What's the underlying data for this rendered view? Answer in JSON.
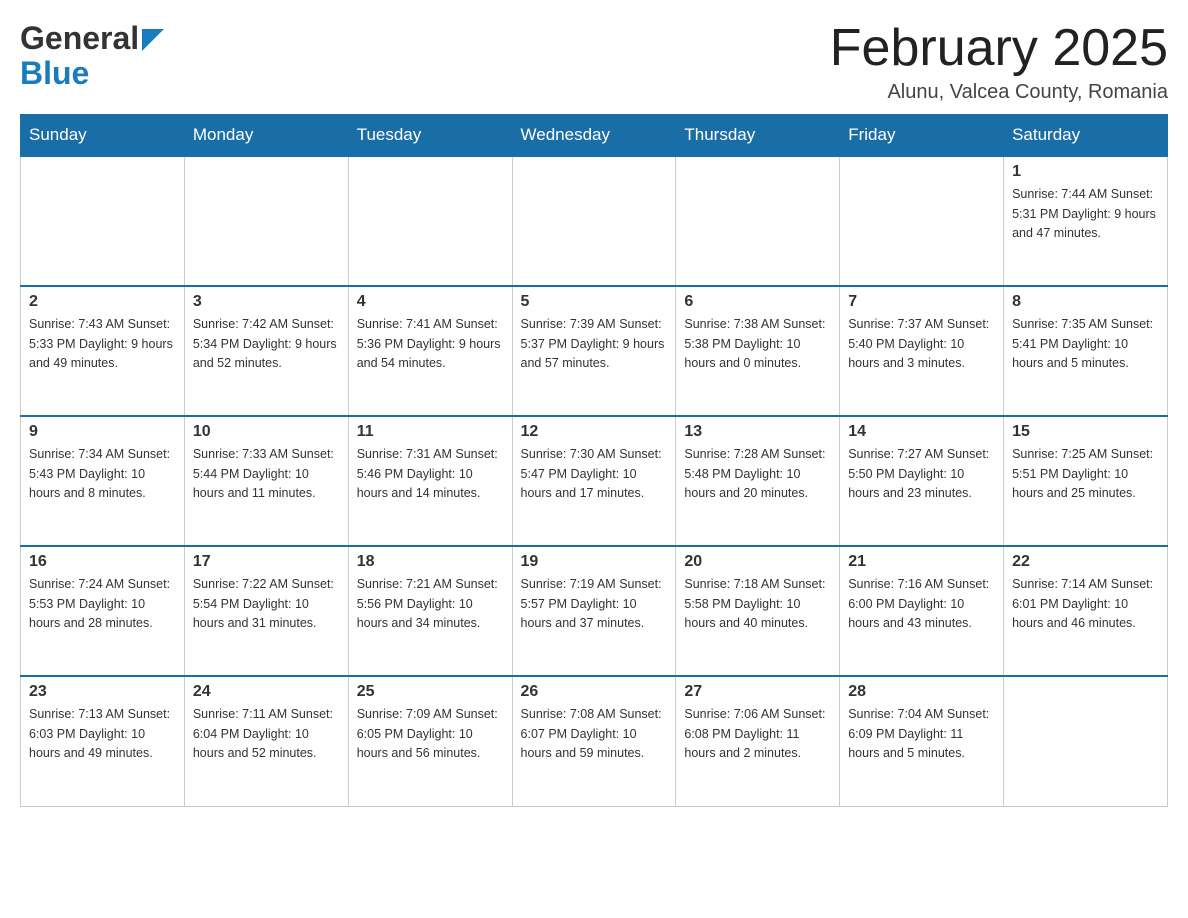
{
  "header": {
    "logo_general": "General",
    "logo_blue": "Blue",
    "month_title": "February 2025",
    "location": "Alunu, Valcea County, Romania"
  },
  "days_of_week": [
    "Sunday",
    "Monday",
    "Tuesday",
    "Wednesday",
    "Thursday",
    "Friday",
    "Saturday"
  ],
  "weeks": [
    [
      {
        "day": "",
        "info": ""
      },
      {
        "day": "",
        "info": ""
      },
      {
        "day": "",
        "info": ""
      },
      {
        "day": "",
        "info": ""
      },
      {
        "day": "",
        "info": ""
      },
      {
        "day": "",
        "info": ""
      },
      {
        "day": "1",
        "info": "Sunrise: 7:44 AM\nSunset: 5:31 PM\nDaylight: 9 hours\nand 47 minutes."
      }
    ],
    [
      {
        "day": "2",
        "info": "Sunrise: 7:43 AM\nSunset: 5:33 PM\nDaylight: 9 hours\nand 49 minutes."
      },
      {
        "day": "3",
        "info": "Sunrise: 7:42 AM\nSunset: 5:34 PM\nDaylight: 9 hours\nand 52 minutes."
      },
      {
        "day": "4",
        "info": "Sunrise: 7:41 AM\nSunset: 5:36 PM\nDaylight: 9 hours\nand 54 minutes."
      },
      {
        "day": "5",
        "info": "Sunrise: 7:39 AM\nSunset: 5:37 PM\nDaylight: 9 hours\nand 57 minutes."
      },
      {
        "day": "6",
        "info": "Sunrise: 7:38 AM\nSunset: 5:38 PM\nDaylight: 10 hours\nand 0 minutes."
      },
      {
        "day": "7",
        "info": "Sunrise: 7:37 AM\nSunset: 5:40 PM\nDaylight: 10 hours\nand 3 minutes."
      },
      {
        "day": "8",
        "info": "Sunrise: 7:35 AM\nSunset: 5:41 PM\nDaylight: 10 hours\nand 5 minutes."
      }
    ],
    [
      {
        "day": "9",
        "info": "Sunrise: 7:34 AM\nSunset: 5:43 PM\nDaylight: 10 hours\nand 8 minutes."
      },
      {
        "day": "10",
        "info": "Sunrise: 7:33 AM\nSunset: 5:44 PM\nDaylight: 10 hours\nand 11 minutes."
      },
      {
        "day": "11",
        "info": "Sunrise: 7:31 AM\nSunset: 5:46 PM\nDaylight: 10 hours\nand 14 minutes."
      },
      {
        "day": "12",
        "info": "Sunrise: 7:30 AM\nSunset: 5:47 PM\nDaylight: 10 hours\nand 17 minutes."
      },
      {
        "day": "13",
        "info": "Sunrise: 7:28 AM\nSunset: 5:48 PM\nDaylight: 10 hours\nand 20 minutes."
      },
      {
        "day": "14",
        "info": "Sunrise: 7:27 AM\nSunset: 5:50 PM\nDaylight: 10 hours\nand 23 minutes."
      },
      {
        "day": "15",
        "info": "Sunrise: 7:25 AM\nSunset: 5:51 PM\nDaylight: 10 hours\nand 25 minutes."
      }
    ],
    [
      {
        "day": "16",
        "info": "Sunrise: 7:24 AM\nSunset: 5:53 PM\nDaylight: 10 hours\nand 28 minutes."
      },
      {
        "day": "17",
        "info": "Sunrise: 7:22 AM\nSunset: 5:54 PM\nDaylight: 10 hours\nand 31 minutes."
      },
      {
        "day": "18",
        "info": "Sunrise: 7:21 AM\nSunset: 5:56 PM\nDaylight: 10 hours\nand 34 minutes."
      },
      {
        "day": "19",
        "info": "Sunrise: 7:19 AM\nSunset: 5:57 PM\nDaylight: 10 hours\nand 37 minutes."
      },
      {
        "day": "20",
        "info": "Sunrise: 7:18 AM\nSunset: 5:58 PM\nDaylight: 10 hours\nand 40 minutes."
      },
      {
        "day": "21",
        "info": "Sunrise: 7:16 AM\nSunset: 6:00 PM\nDaylight: 10 hours\nand 43 minutes."
      },
      {
        "day": "22",
        "info": "Sunrise: 7:14 AM\nSunset: 6:01 PM\nDaylight: 10 hours\nand 46 minutes."
      }
    ],
    [
      {
        "day": "23",
        "info": "Sunrise: 7:13 AM\nSunset: 6:03 PM\nDaylight: 10 hours\nand 49 minutes."
      },
      {
        "day": "24",
        "info": "Sunrise: 7:11 AM\nSunset: 6:04 PM\nDaylight: 10 hours\nand 52 minutes."
      },
      {
        "day": "25",
        "info": "Sunrise: 7:09 AM\nSunset: 6:05 PM\nDaylight: 10 hours\nand 56 minutes."
      },
      {
        "day": "26",
        "info": "Sunrise: 7:08 AM\nSunset: 6:07 PM\nDaylight: 10 hours\nand 59 minutes."
      },
      {
        "day": "27",
        "info": "Sunrise: 7:06 AM\nSunset: 6:08 PM\nDaylight: 11 hours\nand 2 minutes."
      },
      {
        "day": "28",
        "info": "Sunrise: 7:04 AM\nSunset: 6:09 PM\nDaylight: 11 hours\nand 5 minutes."
      },
      {
        "day": "",
        "info": ""
      }
    ]
  ]
}
